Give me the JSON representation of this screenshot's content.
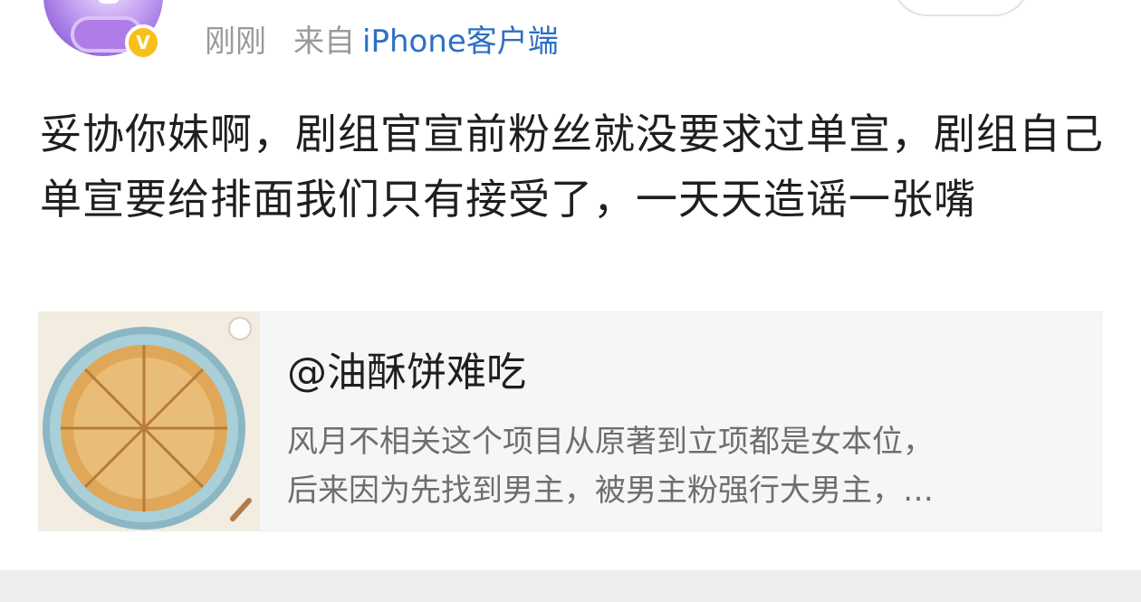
{
  "post": {
    "meta": {
      "time": "刚刚",
      "from_label": "来自",
      "source": "iPhone客户端"
    },
    "text": "妥协你妹啊，剧组官宣前粉丝就没要求过单宣，剧组自己单宣要给排面我们只有接受了，一天天造谣一张嘴",
    "verified_icon": "verified-v-icon"
  },
  "quote": {
    "author": "@油酥饼难吃",
    "excerpt_lines": [
      "风月不相关这个项目从原著到立项都是女本位，",
      "后来因为先找到男主，被男主粉强行大男主，…"
    ]
  },
  "colors": {
    "link": "#2e6fc4",
    "meta_gray": "#9a9a9a",
    "badge": "#f7c11a",
    "card_bg": "#f6f6f6"
  }
}
